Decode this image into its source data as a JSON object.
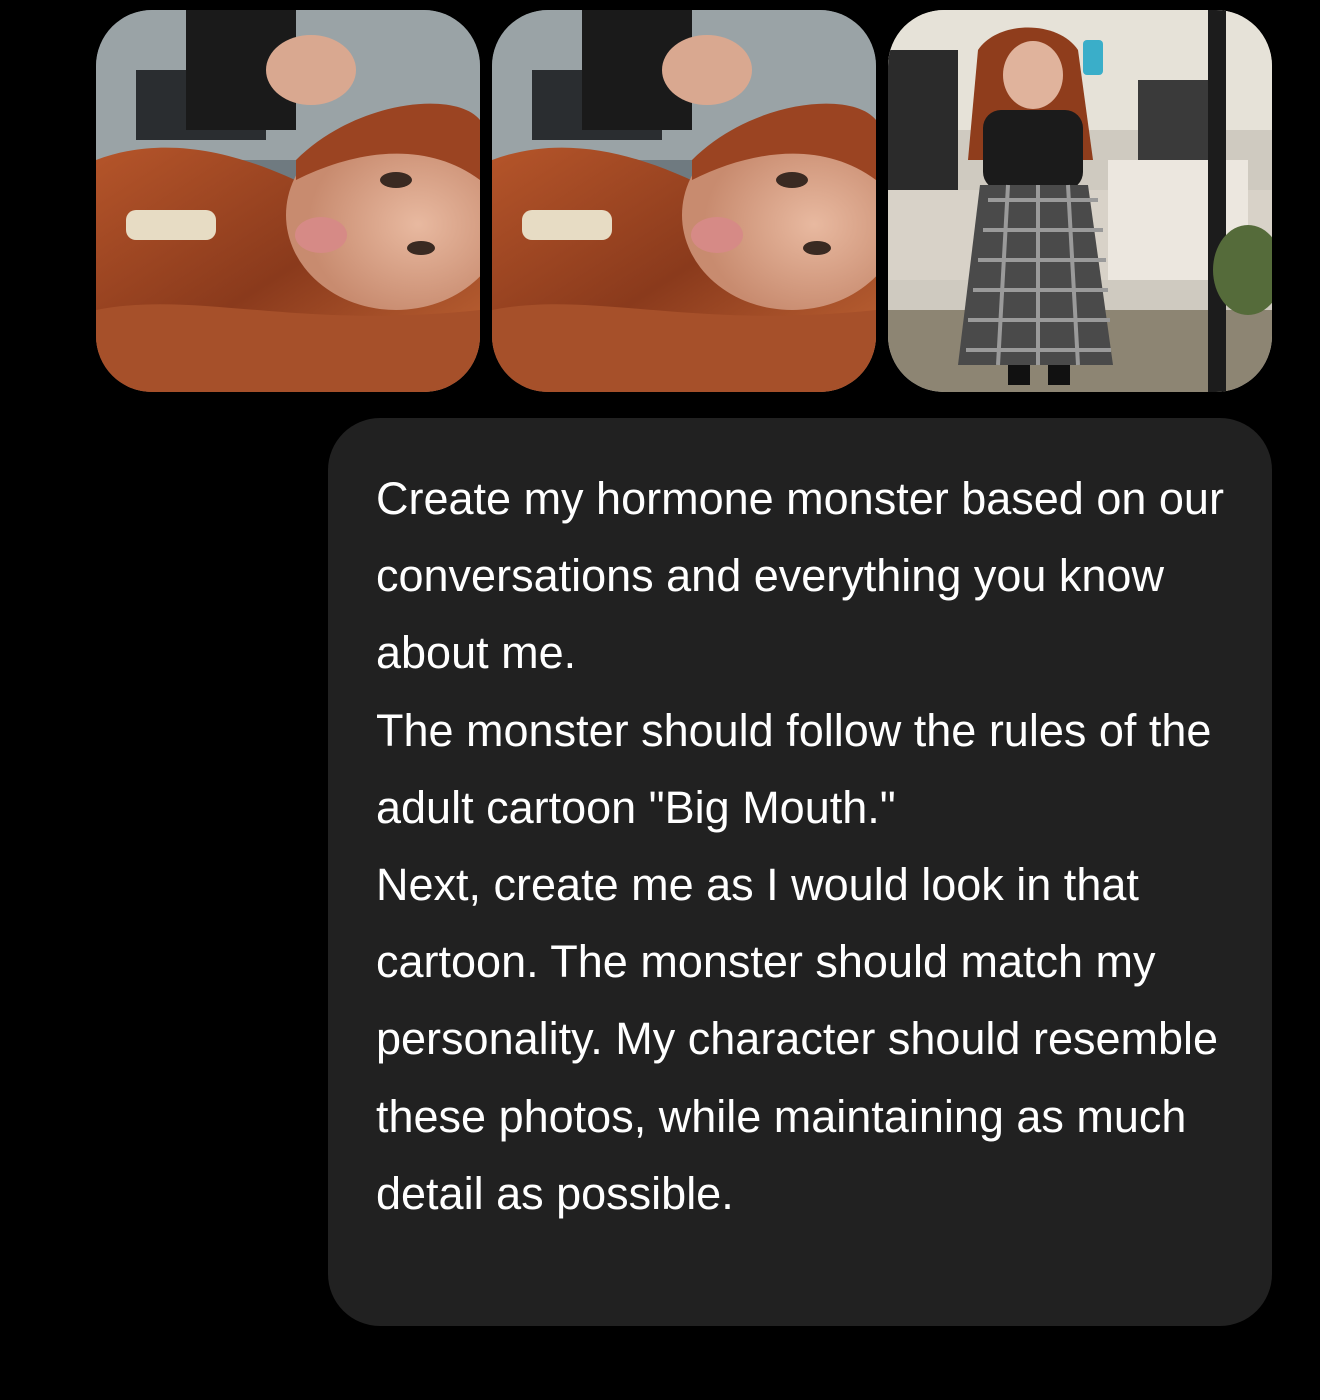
{
  "attachments": [
    {
      "icon": "selfie-car-photo"
    },
    {
      "icon": "selfie-car-photo"
    },
    {
      "icon": "mirror-selfie-bedroom-photo"
    }
  ],
  "colors": {
    "background": "#000000",
    "bubble": "#212121",
    "text": "#ffffff"
  },
  "message": {
    "text": "Create my hormone monster based on our conversations and everything you know about me.\nThe monster should follow the rules of the adult cartoon \"Big Mouth.\"\nNext, create me as I would look in that cartoon. The monster should match my personality. My character should resemble these photos, while maintaining as much detail as possible."
  }
}
